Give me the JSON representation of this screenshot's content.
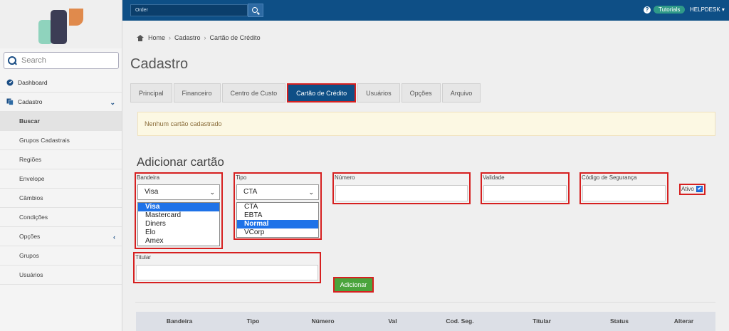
{
  "sidebar": {
    "search_placeholder": "Search",
    "items": [
      {
        "label": "Dashboard",
        "icon": "dashboard-icon"
      },
      {
        "label": "Cadastro",
        "icon": "copy-icon",
        "chevron": "⌄"
      },
      {
        "label": "Buscar"
      },
      {
        "label": "Grupos Cadastrais"
      },
      {
        "label": "Regiões"
      },
      {
        "label": "Envelope"
      },
      {
        "label": "Câmbios"
      },
      {
        "label": "Condições"
      },
      {
        "label": "Opções",
        "chevron": "‹"
      },
      {
        "label": "Grupos"
      },
      {
        "label": "Usuários"
      }
    ]
  },
  "topbar": {
    "order_placeholder": "Order",
    "tutorials_label": "Tutorials",
    "help_icon": "?",
    "helpdesk_label": "HELPDESK ▾"
  },
  "breadcrumb": {
    "home": "Home",
    "cadastro": "Cadastro",
    "current": "Cartão de Crédito",
    "sep": "›"
  },
  "page_title": "Cadastro",
  "tabs": [
    {
      "label": "Principal"
    },
    {
      "label": "Financeiro"
    },
    {
      "label": "Centro de Custo"
    },
    {
      "label": "Cartão de Crédito",
      "active": true
    },
    {
      "label": "Usuários"
    },
    {
      "label": "Opções"
    },
    {
      "label": "Arquivo"
    }
  ],
  "alert_text": "Nenhum cartão cadastrado",
  "form": {
    "title": "Adicionar cartão",
    "bandeira": {
      "label": "Bandeira",
      "value": "Visa",
      "options": [
        "Visa",
        "Mastercard",
        "Diners",
        "Elo",
        "Amex"
      ]
    },
    "tipo": {
      "label": "Tipo",
      "value": "CTA",
      "options": [
        "CTA",
        "EBTA",
        "Normal",
        "VCorp"
      ],
      "highlighted": "Normal"
    },
    "numero_label": "Número",
    "validade_label": "Validade",
    "codigo_label": "Código de Segurança",
    "ativo_label": "Ativo",
    "ativo_checked": "✔",
    "titular_label": "Titular",
    "add_button": "Adicionar"
  },
  "table": {
    "headers": [
      "Bandeira",
      "Tipo",
      "Número",
      "Val",
      "Cod. Seg.",
      "Titular",
      "Status",
      "Alterar"
    ]
  },
  "colors": {
    "topbar": "#0e4f86",
    "accent": "#1e72e8",
    "button": "#4aa43c",
    "highlight": "#d62020"
  }
}
